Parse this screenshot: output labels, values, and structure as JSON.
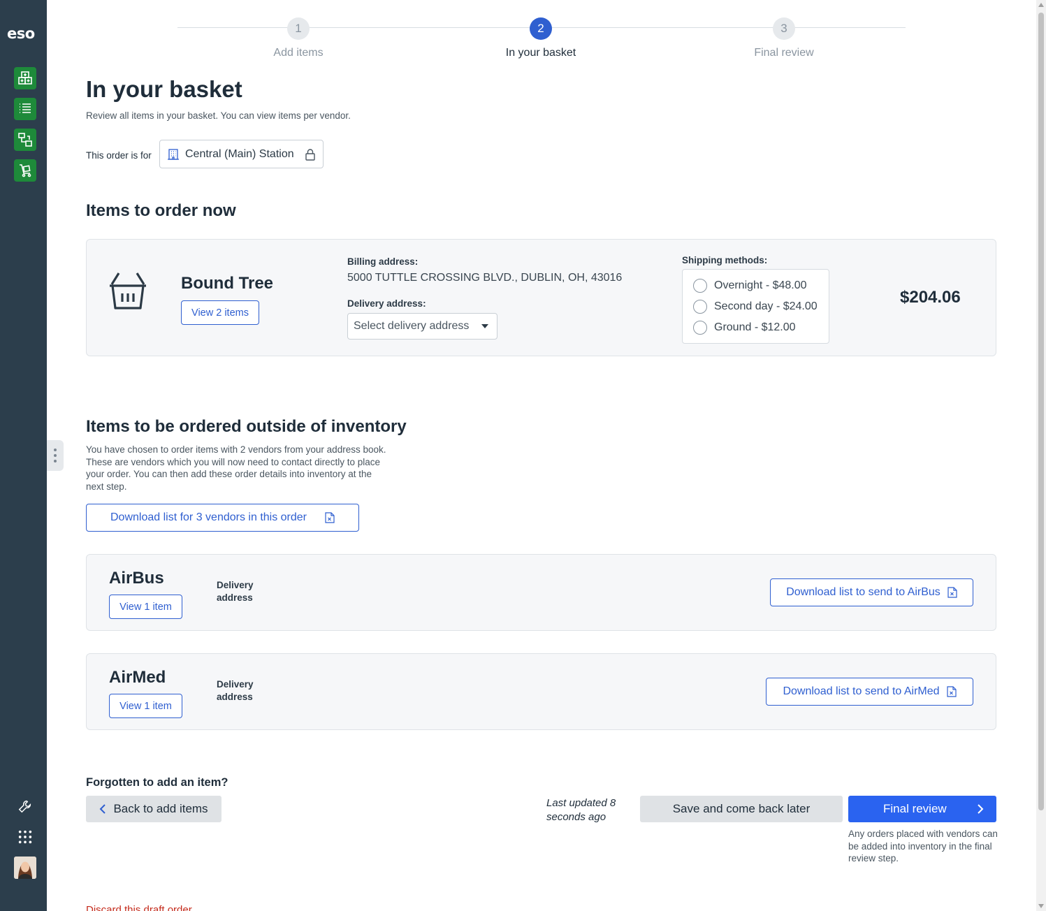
{
  "sidebar": {
    "logo": "eso",
    "icons": [
      "inventory-grid-icon",
      "list-icon",
      "transfer-icon",
      "cart-icon"
    ],
    "tools": [
      "wrench-icon",
      "apps-grid-icon"
    ]
  },
  "stepper": {
    "steps": [
      {
        "number": "1",
        "label": "Add items",
        "state": "inactive"
      },
      {
        "number": "2",
        "label": "In your basket",
        "state": "active"
      },
      {
        "number": "3",
        "label": "Final review",
        "state": "inactive"
      }
    ]
  },
  "page": {
    "title": "In your basket",
    "subtitle": "Review all items in your basket. You can view items per vendor.",
    "order_for_label": "This order is for",
    "station": "Central (Main) Station"
  },
  "order_now": {
    "heading": "Items to order now",
    "vendor": {
      "name": "Bound Tree",
      "view_button": "View 2 items",
      "billing_label": "Billing address:",
      "billing_address": "5000 TUTTLE CROSSING BLVD., DUBLIN, OH, 43016",
      "delivery_label": "Delivery address:",
      "delivery_placeholder": "Select delivery address",
      "shipping_label": "Shipping methods:",
      "shipping_options": [
        "Overnight - $48.00",
        "Second day - $24.00",
        "Ground - $12.00"
      ],
      "total": "$204.06"
    }
  },
  "outside": {
    "heading": "Items to be ordered outside of inventory",
    "description": "You have chosen to order items with 2 vendors from your address book. These are vendors which you will now need to contact directly to place your order. You can then add these order details into inventory at the next step.",
    "download_all": "Download list for 3 vendors in this order",
    "vendors": [
      {
        "name": "AirBus",
        "view_button": "View 1 item",
        "delivery_label": "Delivery address",
        "download": "Download list to send to AirBus"
      },
      {
        "name": "AirMed",
        "view_button": "View 1 item",
        "delivery_label": "Delivery address",
        "download": "Download list to send to AirMed"
      }
    ]
  },
  "footer": {
    "forgot": "Forgotten to add an item?",
    "back_button": "Back to add items",
    "last_updated": "Last updated 8 seconds ago",
    "save_button": "Save and come back later",
    "final_button": "Final review",
    "final_note": "Any orders placed with vendors can be added into inventory in the final review step.",
    "discard": "Discard this draft order"
  },
  "colors": {
    "sidebar": "#2c3e4c",
    "accent": "#2f5fd0",
    "primary_button": "#2a63f0",
    "nav_green": "#1e8a3a",
    "danger": "#c42b1c"
  }
}
